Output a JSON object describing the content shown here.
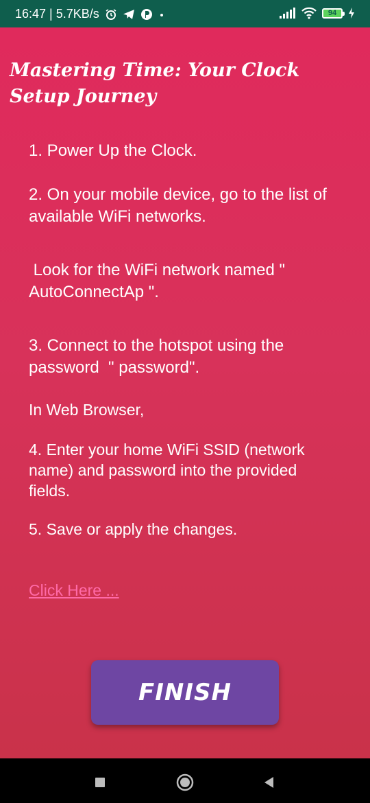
{
  "status_bar": {
    "left_text": "16:47 | 5.7KB/s",
    "battery": "94",
    "icons": [
      "alarm-icon",
      "telegram-icon",
      "app-icon",
      "dot-icon",
      "signal-icon",
      "wifi-icon",
      "battery-icon",
      "charging-icon"
    ]
  },
  "page": {
    "title": "Mastering Time: Your Clock Setup Journey",
    "steps": [
      "1. Power Up the Clock.",
      "2. On your mobile device, go to the list of available WiFi networks.",
      " Look for the WiFi network named \" AutoConnectAp \".",
      "3. Connect to the hotspot using the password  \" password\".",
      "In Web Browser,",
      "4. Enter your home WiFi SSID (network name) and password into the provided fields.",
      "5. Save or apply the changes."
    ],
    "link_label": "Click Here ...",
    "finish_label": "FINISH"
  },
  "colors": {
    "status_bar": "#0f5e4d",
    "background_top": "#e02a5c",
    "background_bottom": "#c9324a",
    "button": "#6e46a3",
    "link": "#ff6aa8"
  },
  "nav_bar": {
    "icons": [
      "recents-icon",
      "home-icon",
      "back-icon"
    ]
  }
}
